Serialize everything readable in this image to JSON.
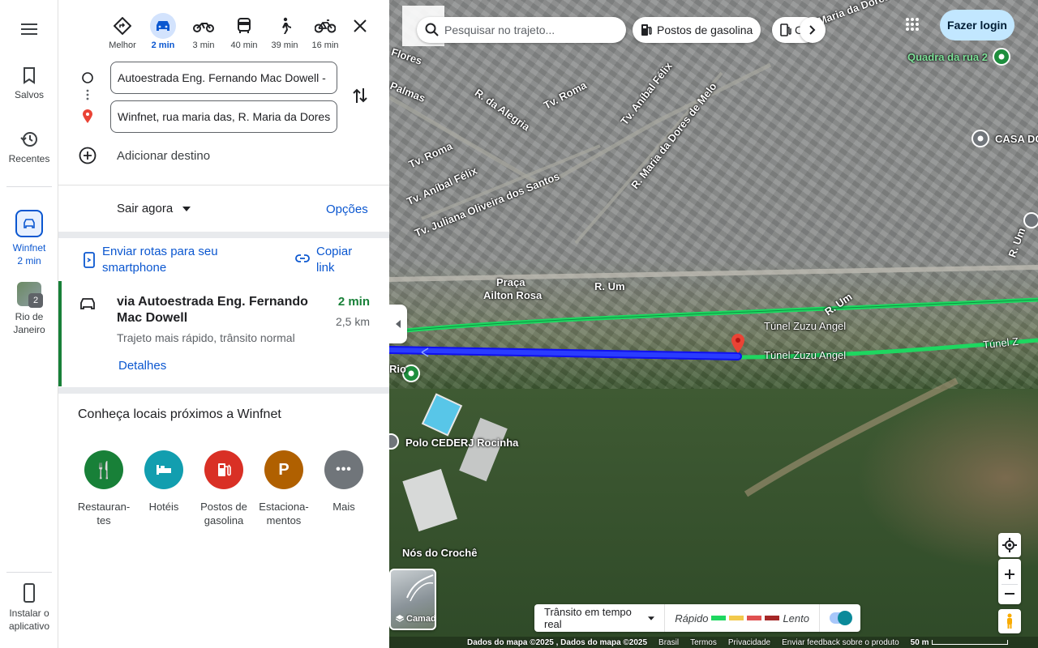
{
  "rail": {
    "saved": "Salvos",
    "recents": "Recentes",
    "trip_label": "Winfnet",
    "trip_time": "2 min",
    "city_label_1": "Rio de",
    "city_label_2": "Janeiro",
    "city_badge": "2",
    "install_1": "Instalar o",
    "install_2": "aplicativo"
  },
  "modes": [
    {
      "label": "Melhor",
      "icon": "diamond-turn-icon"
    },
    {
      "label": "2 min",
      "icon": "car-icon"
    },
    {
      "label": "3 min",
      "icon": "motorcycle-icon"
    },
    {
      "label": "40 min",
      "icon": "bus-icon"
    },
    {
      "label": "39 min",
      "icon": "walk-icon"
    },
    {
      "label": "16 min",
      "icon": "bike-icon"
    }
  ],
  "route": {
    "origin": "Autoestrada Eng. Fernando Mac Dowell - ",
    "destination": "Winfnet, rua maria das, R. Maria da Dores",
    "add_destination": "Adicionar destino",
    "depart": "Sair agora",
    "options": "Opções",
    "send": "Enviar rotas para seu smartphone",
    "copy": "Copiar link",
    "via": "via Autoestrada Eng. Fernando Mac Dowell",
    "time": "2 min",
    "distance": "2,5 km",
    "summary": "Trajeto mais rápido, trânsito normal",
    "details": "Detalhes"
  },
  "nearby": {
    "title": "Conheça locais próximos a Winfnet",
    "categories": [
      {
        "l1": "Restauran-",
        "l2": "tes",
        "color": "#188038",
        "glyph": "🍴"
      },
      {
        "l1": "Hotéis",
        "l2": "",
        "color": "#129eaf",
        "glyph": "🛏"
      },
      {
        "l1": "Postos de",
        "l2": "gasolina",
        "color": "#d93025",
        "glyph": "⛽"
      },
      {
        "l1": "Estaciona-",
        "l2": "mentos",
        "color": "#b06000",
        "glyph": "P"
      },
      {
        "l1": "Mais",
        "l2": "",
        "color": "#70757a",
        "glyph": "•••"
      }
    ]
  },
  "map": {
    "search_placeholder": "Pesquisar no trajeto...",
    "chip_gas": "Postos de gasolina",
    "chip_more": "C",
    "login": "Fazer login",
    "labels": {
      "flores": "Flores",
      "palmas": "Palmas",
      "alegria": "R. da Alegria",
      "roma1": "Tv. Roma",
      "roma2": "Tv. Roma",
      "felix1": "Tv. Aníbal Félix",
      "felix2": "Tv. Aníbal Félix",
      "dores": "R. Maria da Dores de Melo",
      "juliana": "Tv. Juliana Oliveira dos Santos",
      "dores_top": "R. Maria da Dores",
      "quadra": "Quadra da rua 2",
      "casa": "CASA DO",
      "praca1": "Praça",
      "praca2": "Ailton Rosa",
      "rum1": "R. Um",
      "rum2": "R. Um",
      "rum3": "R. Um",
      "tunel1": "Túnel Zuzu Angel",
      "tunel2": "Túnel Zuzu Angel",
      "tunel3": "Túnel Z",
      "polo": "Polo CEDERJ Rocinha",
      "croche": "Nós do Crochê",
      "rio": "Rio",
      "cinha": "cinha"
    },
    "traffic": "Trânsito em tempo real",
    "fast": "Rápido",
    "slow": "Lento",
    "layers": "Camadas",
    "attribution": [
      "Dados do mapa ©2025 , Dados do mapa ©2025",
      "Brasil",
      "Termos",
      "Privacidade",
      "Enviar feedback sobre o produto",
      "50 m"
    ]
  },
  "colors": {
    "accent": "#0b57d0",
    "route": "#1a1aff",
    "traffic_green": "#1ed760",
    "traffic_yellow": "#f2c94c",
    "traffic_red": "#e05050",
    "traffic_dark": "#a52727"
  }
}
